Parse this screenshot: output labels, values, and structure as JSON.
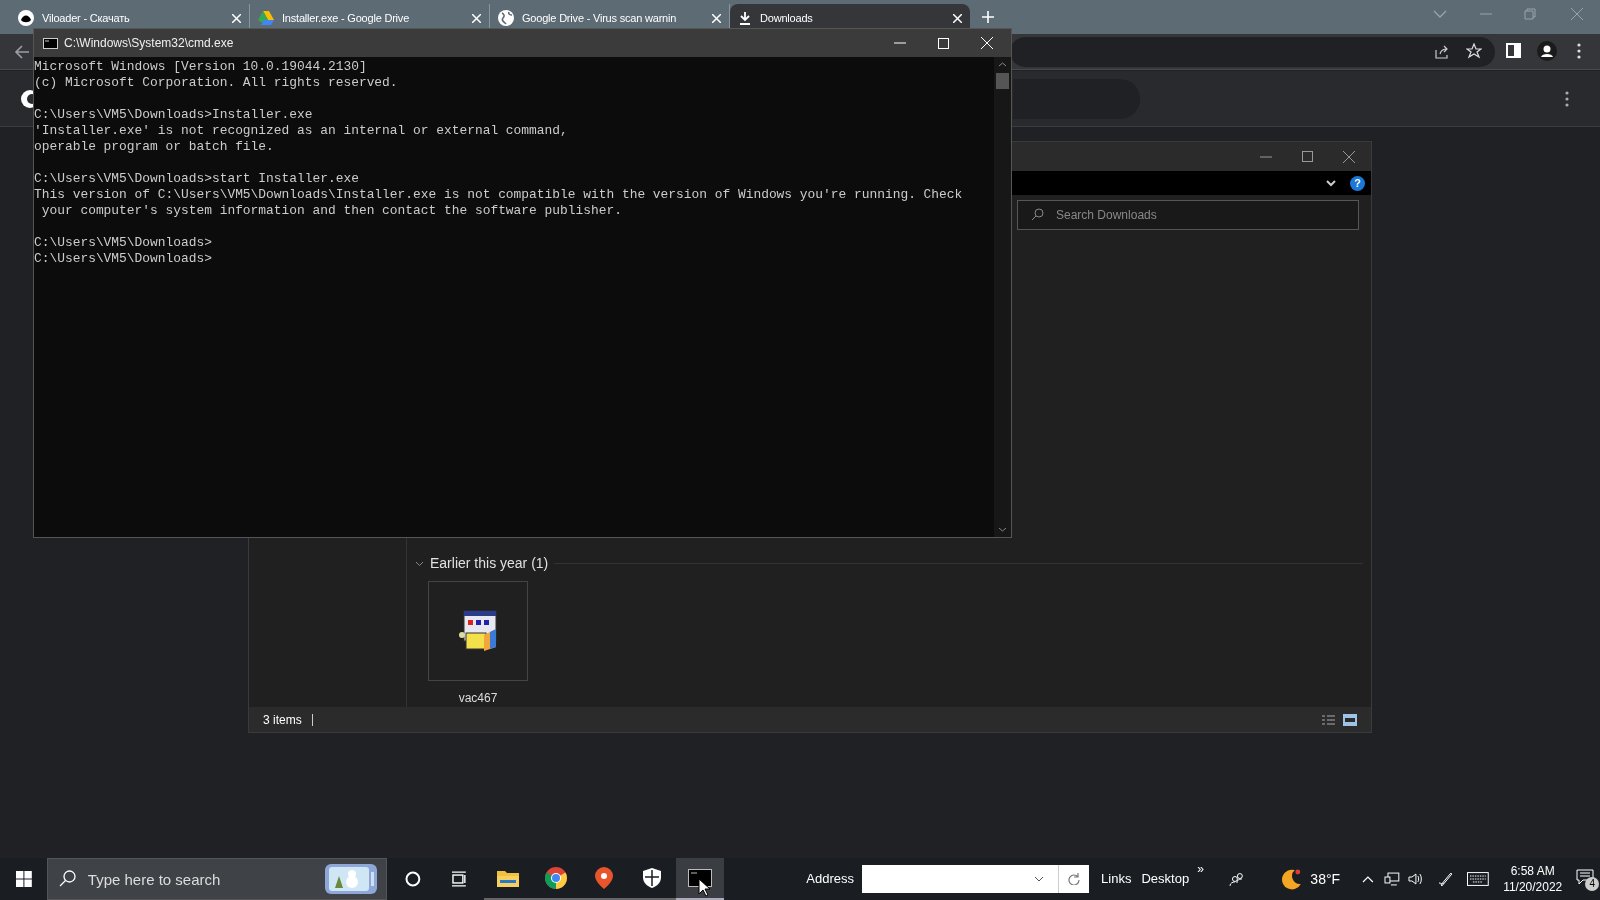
{
  "browser": {
    "tabs": [
      {
        "title": "Viloader - Скачать",
        "selected": false,
        "kind": "site"
      },
      {
        "title": "Installer.exe - Google Drive",
        "selected": false,
        "kind": "drive"
      },
      {
        "title": "Google Drive - Virus scan warnin",
        "selected": false,
        "kind": "globe"
      },
      {
        "title": "Downloads",
        "selected": true,
        "kind": "download"
      }
    ]
  },
  "explorer": {
    "help": "?",
    "search": {
      "placeholder": "Search Downloads"
    },
    "groups": [
      {
        "label": "Earlier this year (1)",
        "expanded": true,
        "items": [
          {
            "name": "vac467"
          }
        ]
      }
    ],
    "status_bar": "3 items"
  },
  "cmd": {
    "title": "C:\\Windows\\System32\\cmd.exe",
    "blocks": [
      [
        "Microsoft Windows [Version 10.0.19044.2130]",
        "(c) Microsoft Corporation. All rights reserved."
      ],
      [
        "C:\\Users\\VM5\\Downloads>Installer.exe",
        "'Installer.exe' is not recognized as an internal or external command,",
        "operable program or batch file."
      ],
      [
        "C:\\Users\\VM5\\Downloads>start Installer.exe",
        "This version of C:\\Users\\VM5\\Downloads\\Installer.exe is not compatible with the version of Windows you're running. Check",
        " your computer's system information and then contact the software publisher."
      ],
      [
        "C:\\Users\\VM5\\Downloads>",
        "C:\\Users\\VM5\\Downloads>"
      ]
    ]
  },
  "taskbar": {
    "search": {
      "placeholder": "Type here to search"
    },
    "apps": [
      {
        "kind": "explorer",
        "selected": false
      },
      {
        "kind": "chrome",
        "selected": false
      },
      {
        "kind": "maps",
        "selected": false
      },
      {
        "kind": "security",
        "selected": false
      },
      {
        "kind": "terminal",
        "selected": true
      }
    ],
    "address_label": "Address",
    "links": "Links",
    "desktop": "Desktop",
    "overflow": "»",
    "temperature": "38°F",
    "time": "6:58 AM",
    "date": "11/20/2022",
    "notifications": "4"
  }
}
